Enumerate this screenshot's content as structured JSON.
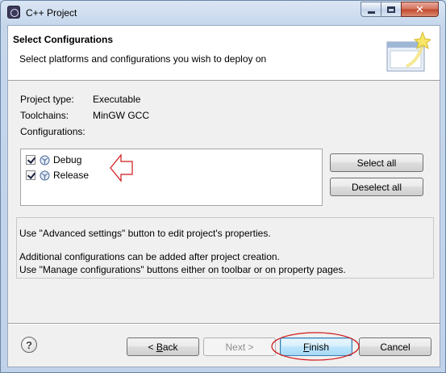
{
  "window": {
    "title": "C++ Project",
    "min_glyph": "",
    "max_glyph": "",
    "close_glyph": "✕"
  },
  "header": {
    "title": "Select Configurations",
    "subtitle": "Select platforms and configurations you wish to deploy on"
  },
  "info": {
    "project_type_label": "Project type:",
    "project_type_value": "Executable",
    "toolchains_label": "Toolchains:",
    "toolchains_value": "MinGW GCC",
    "configurations_label": "Configurations:"
  },
  "configurations": [
    {
      "label": "Debug",
      "checked": true
    },
    {
      "label": "Release",
      "checked": true
    }
  ],
  "buttons": {
    "select_all": "Select all",
    "deselect_all": "Deselect all",
    "back_underlined": "B",
    "back_rest": "ack",
    "back_prefix": "< ",
    "next": "Next >",
    "finish_underlined": "F",
    "finish_rest": "inish",
    "cancel": "Cancel",
    "help_glyph": "?"
  },
  "hints": {
    "line1": "Use \"Advanced settings\" button to edit project's properties.",
    "line2": "Additional configurations can be added after project creation.",
    "line3": "Use \"Manage configurations\" buttons either on toolbar or on property pages."
  },
  "colors": {
    "annotation_red": "#d01818",
    "default_button_border": "#3c7fb1"
  },
  "icons": {
    "app": "eclipse-cdt-icon",
    "config": "gear-icon",
    "wizard": "wizard-graphic-icon",
    "help": "help-icon"
  }
}
